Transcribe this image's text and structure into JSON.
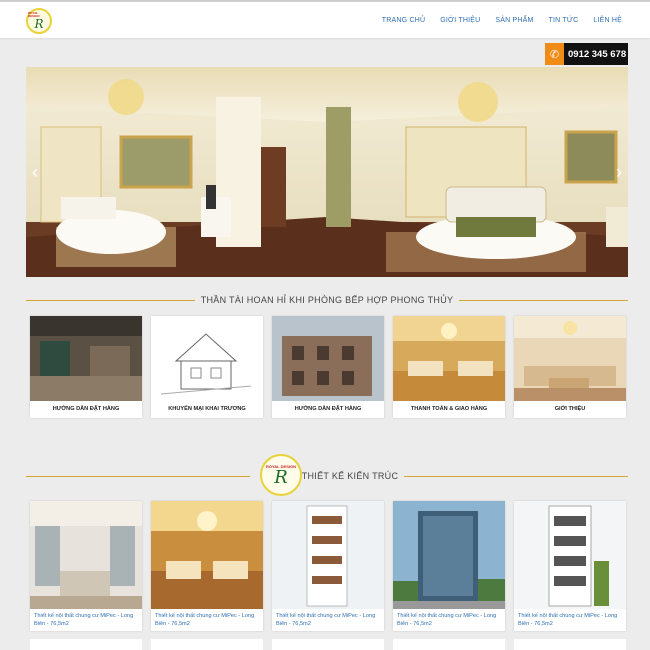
{
  "header": {
    "logo_text": "ROYAL DESIGN",
    "logo_letter": "R",
    "nav": [
      "TRANG CHỦ",
      "GIỚI THIỆU",
      "SẢN PHẨM",
      "TIN TỨC",
      "LIÊN HỆ"
    ]
  },
  "phone": {
    "icon": "phone-icon",
    "number": "0912 345 678"
  },
  "slider": {
    "prev": "‹",
    "next": "›"
  },
  "section1": {
    "title": "THẦN TÀI HOAN HỈ KHI PHÒNG BẾP HỢP PHONG THỦY",
    "cards": [
      "HƯỚNG DẪN ĐẶT HÀNG",
      "KHUYẾN MẠI KHAI TRƯƠNG",
      "HƯỚNG DẪN ĐẶT HÀNG",
      "THANH TOÁN & GIAO HÀNG",
      "GIỚI THIỆU"
    ]
  },
  "section2": {
    "title": "THIẾT KẾ KIẾN TRÚC",
    "badge_text": "ROYAL DESIGN",
    "badge_letter": "R",
    "cards": [
      "Thiết kế nội thất chung cư MiPec - Long Biên - 76,5m2",
      "Thiết kế nội thất chung cư MiPec - Long Biên - 76,5m2",
      "Thiết kế nội thất chung cư MiPec - Long Biên - 76,5m2",
      "Thiết kế nội thất chung cư MiPec - Long Biên - 76,5m2",
      "Thiết kế nội thất chung cư MiPec - Long Biên - 76,5m2"
    ]
  },
  "colors": {
    "accent": "#d7a630",
    "link": "#2f6fb3",
    "phone_bg": "#111111",
    "phone_icon_bg": "#f08b16"
  }
}
